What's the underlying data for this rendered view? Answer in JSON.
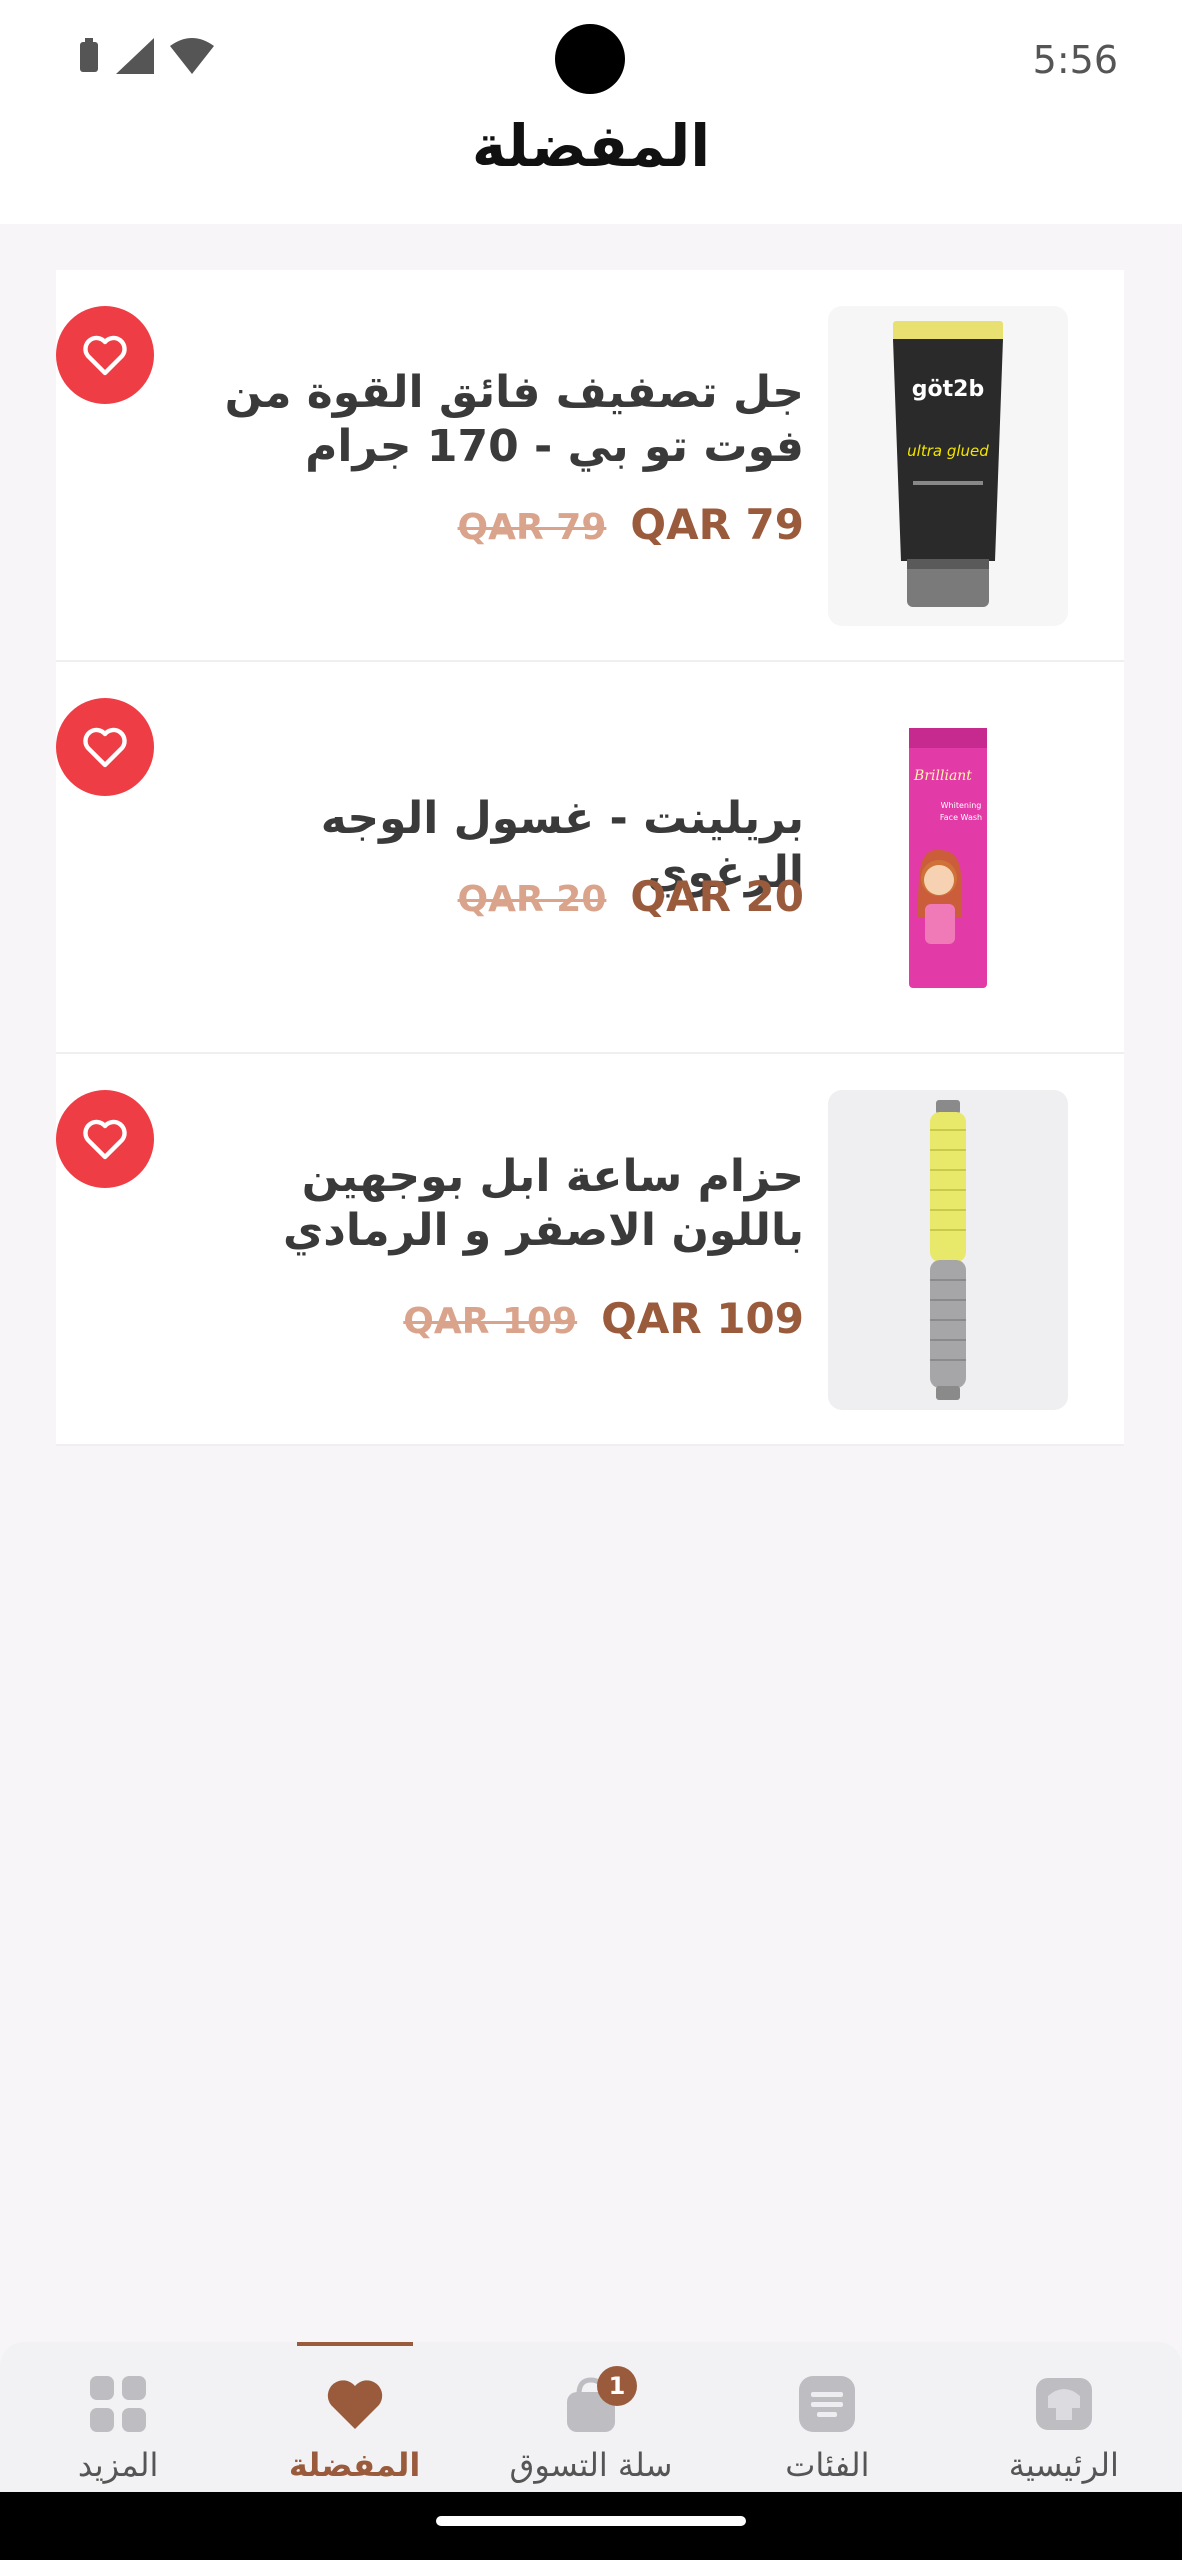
{
  "status": {
    "time": "5:56"
  },
  "header": {
    "title": "المفضلة"
  },
  "products": [
    {
      "name": "جل تصفيف فائق القوة من فوت تو بي - 170 جرام",
      "price": "QAR  79",
      "old_price": "QAR 79",
      "image": "hair-gel-tube",
      "image_text": "göt2b"
    },
    {
      "name": "بريلينت - غسول الوجه الرغوي",
      "price": "QAR  20",
      "old_price": "QAR 20",
      "image": "face-wash-box",
      "image_text": "Brilliant"
    },
    {
      "name": "حزام ساعة ابل بوجهين باللون الاصفر و الرمادي",
      "price": "QAR  109",
      "old_price": "QAR 109",
      "image": "watch-band",
      "image_text": ""
    }
  ],
  "nav": {
    "items": [
      {
        "label": "الرئيسية",
        "icon": "home-icon"
      },
      {
        "label": "الفئات",
        "icon": "categories-icon"
      },
      {
        "label": "سلة التسوق",
        "icon": "cart-icon",
        "badge": "1"
      },
      {
        "label": "المفضلة",
        "icon": "heart-icon",
        "active": true
      },
      {
        "label": "المزيد",
        "icon": "more-icon"
      }
    ]
  },
  "colors": {
    "accent": "#9a5b3d",
    "fav": "#ef3d45",
    "old_price": "#d9a48b"
  }
}
